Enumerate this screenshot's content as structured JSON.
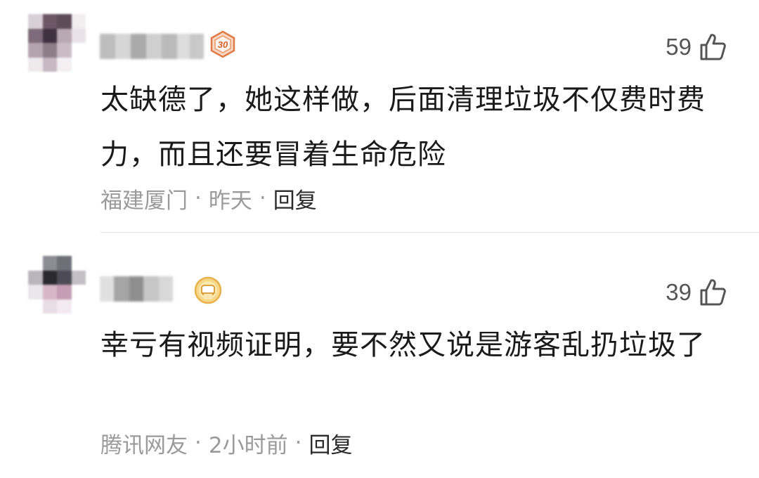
{
  "comments": [
    {
      "badge_level": "30",
      "likes": "59",
      "text": "太缺德了，她这样做，后面清理垃圾不仅费时费力，而且还要冒着生命危险",
      "location": "福建厦门",
      "separator": "·",
      "time": "昨天",
      "reply_label": "回复"
    },
    {
      "likes": "39",
      "text": "幸亏有视频证明，要不然又说是游客乱扔垃圾了",
      "location": "腾讯网友",
      "separator": "·",
      "time": "2小时前",
      "reply_label": "回复"
    }
  ],
  "colors": {
    "badge_bronze": "#e07a45",
    "badge_gold": "#e8b14a",
    "like_icon": "#555555",
    "meta_text": "#9a9a9a"
  },
  "icons": {
    "like": "thumbs-up-icon",
    "level_badge": "level-badge-icon",
    "vip_badge": "sofa-badge-icon"
  }
}
